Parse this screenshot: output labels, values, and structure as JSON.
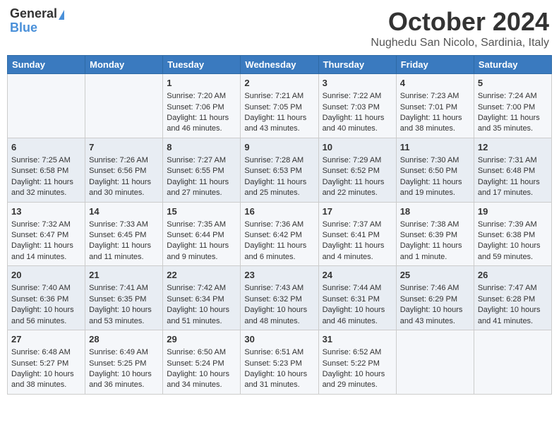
{
  "header": {
    "logo_general": "General",
    "logo_blue": "Blue",
    "month_title": "October 2024",
    "location": "Nughedu San Nicolo, Sardinia, Italy"
  },
  "days_of_week": [
    "Sunday",
    "Monday",
    "Tuesday",
    "Wednesday",
    "Thursday",
    "Friday",
    "Saturday"
  ],
  "weeks": [
    [
      {
        "day": "",
        "sunrise": "",
        "sunset": "",
        "daylight": ""
      },
      {
        "day": "",
        "sunrise": "",
        "sunset": "",
        "daylight": ""
      },
      {
        "day": "1",
        "sunrise": "Sunrise: 7:20 AM",
        "sunset": "Sunset: 7:06 PM",
        "daylight": "Daylight: 11 hours and 46 minutes."
      },
      {
        "day": "2",
        "sunrise": "Sunrise: 7:21 AM",
        "sunset": "Sunset: 7:05 PM",
        "daylight": "Daylight: 11 hours and 43 minutes."
      },
      {
        "day": "3",
        "sunrise": "Sunrise: 7:22 AM",
        "sunset": "Sunset: 7:03 PM",
        "daylight": "Daylight: 11 hours and 40 minutes."
      },
      {
        "day": "4",
        "sunrise": "Sunrise: 7:23 AM",
        "sunset": "Sunset: 7:01 PM",
        "daylight": "Daylight: 11 hours and 38 minutes."
      },
      {
        "day": "5",
        "sunrise": "Sunrise: 7:24 AM",
        "sunset": "Sunset: 7:00 PM",
        "daylight": "Daylight: 11 hours and 35 minutes."
      }
    ],
    [
      {
        "day": "6",
        "sunrise": "Sunrise: 7:25 AM",
        "sunset": "Sunset: 6:58 PM",
        "daylight": "Daylight: 11 hours and 32 minutes."
      },
      {
        "day": "7",
        "sunrise": "Sunrise: 7:26 AM",
        "sunset": "Sunset: 6:56 PM",
        "daylight": "Daylight: 11 hours and 30 minutes."
      },
      {
        "day": "8",
        "sunrise": "Sunrise: 7:27 AM",
        "sunset": "Sunset: 6:55 PM",
        "daylight": "Daylight: 11 hours and 27 minutes."
      },
      {
        "day": "9",
        "sunrise": "Sunrise: 7:28 AM",
        "sunset": "Sunset: 6:53 PM",
        "daylight": "Daylight: 11 hours and 25 minutes."
      },
      {
        "day": "10",
        "sunrise": "Sunrise: 7:29 AM",
        "sunset": "Sunset: 6:52 PM",
        "daylight": "Daylight: 11 hours and 22 minutes."
      },
      {
        "day": "11",
        "sunrise": "Sunrise: 7:30 AM",
        "sunset": "Sunset: 6:50 PM",
        "daylight": "Daylight: 11 hours and 19 minutes."
      },
      {
        "day": "12",
        "sunrise": "Sunrise: 7:31 AM",
        "sunset": "Sunset: 6:48 PM",
        "daylight": "Daylight: 11 hours and 17 minutes."
      }
    ],
    [
      {
        "day": "13",
        "sunrise": "Sunrise: 7:32 AM",
        "sunset": "Sunset: 6:47 PM",
        "daylight": "Daylight: 11 hours and 14 minutes."
      },
      {
        "day": "14",
        "sunrise": "Sunrise: 7:33 AM",
        "sunset": "Sunset: 6:45 PM",
        "daylight": "Daylight: 11 hours and 11 minutes."
      },
      {
        "day": "15",
        "sunrise": "Sunrise: 7:35 AM",
        "sunset": "Sunset: 6:44 PM",
        "daylight": "Daylight: 11 hours and 9 minutes."
      },
      {
        "day": "16",
        "sunrise": "Sunrise: 7:36 AM",
        "sunset": "Sunset: 6:42 PM",
        "daylight": "Daylight: 11 hours and 6 minutes."
      },
      {
        "day": "17",
        "sunrise": "Sunrise: 7:37 AM",
        "sunset": "Sunset: 6:41 PM",
        "daylight": "Daylight: 11 hours and 4 minutes."
      },
      {
        "day": "18",
        "sunrise": "Sunrise: 7:38 AM",
        "sunset": "Sunset: 6:39 PM",
        "daylight": "Daylight: 11 hours and 1 minute."
      },
      {
        "day": "19",
        "sunrise": "Sunrise: 7:39 AM",
        "sunset": "Sunset: 6:38 PM",
        "daylight": "Daylight: 10 hours and 59 minutes."
      }
    ],
    [
      {
        "day": "20",
        "sunrise": "Sunrise: 7:40 AM",
        "sunset": "Sunset: 6:36 PM",
        "daylight": "Daylight: 10 hours and 56 minutes."
      },
      {
        "day": "21",
        "sunrise": "Sunrise: 7:41 AM",
        "sunset": "Sunset: 6:35 PM",
        "daylight": "Daylight: 10 hours and 53 minutes."
      },
      {
        "day": "22",
        "sunrise": "Sunrise: 7:42 AM",
        "sunset": "Sunset: 6:34 PM",
        "daylight": "Daylight: 10 hours and 51 minutes."
      },
      {
        "day": "23",
        "sunrise": "Sunrise: 7:43 AM",
        "sunset": "Sunset: 6:32 PM",
        "daylight": "Daylight: 10 hours and 48 minutes."
      },
      {
        "day": "24",
        "sunrise": "Sunrise: 7:44 AM",
        "sunset": "Sunset: 6:31 PM",
        "daylight": "Daylight: 10 hours and 46 minutes."
      },
      {
        "day": "25",
        "sunrise": "Sunrise: 7:46 AM",
        "sunset": "Sunset: 6:29 PM",
        "daylight": "Daylight: 10 hours and 43 minutes."
      },
      {
        "day": "26",
        "sunrise": "Sunrise: 7:47 AM",
        "sunset": "Sunset: 6:28 PM",
        "daylight": "Daylight: 10 hours and 41 minutes."
      }
    ],
    [
      {
        "day": "27",
        "sunrise": "Sunrise: 6:48 AM",
        "sunset": "Sunset: 5:27 PM",
        "daylight": "Daylight: 10 hours and 38 minutes."
      },
      {
        "day": "28",
        "sunrise": "Sunrise: 6:49 AM",
        "sunset": "Sunset: 5:25 PM",
        "daylight": "Daylight: 10 hours and 36 minutes."
      },
      {
        "day": "29",
        "sunrise": "Sunrise: 6:50 AM",
        "sunset": "Sunset: 5:24 PM",
        "daylight": "Daylight: 10 hours and 34 minutes."
      },
      {
        "day": "30",
        "sunrise": "Sunrise: 6:51 AM",
        "sunset": "Sunset: 5:23 PM",
        "daylight": "Daylight: 10 hours and 31 minutes."
      },
      {
        "day": "31",
        "sunrise": "Sunrise: 6:52 AM",
        "sunset": "Sunset: 5:22 PM",
        "daylight": "Daylight: 10 hours and 29 minutes."
      },
      {
        "day": "",
        "sunrise": "",
        "sunset": "",
        "daylight": ""
      },
      {
        "day": "",
        "sunrise": "",
        "sunset": "",
        "daylight": ""
      }
    ]
  ]
}
